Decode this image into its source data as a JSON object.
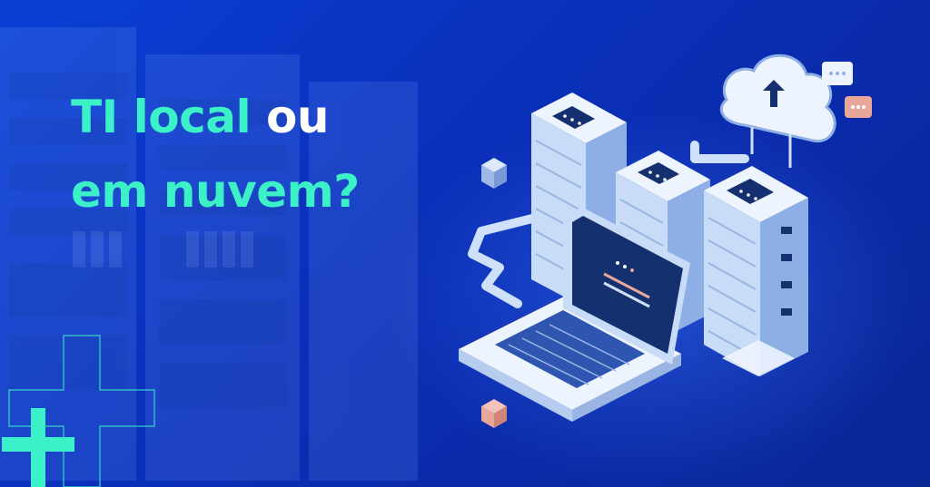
{
  "headline": {
    "part1": "TI local",
    "part2": "ou",
    "part3": "em nuvem?"
  },
  "colors": {
    "background": "#0a34c8",
    "accent": "#3cf0c8",
    "text": "#ffffff",
    "server": "#c9dcf7",
    "server_dark": "#14306e",
    "coral": "#e9a79c"
  },
  "icons": [
    "server-rack-icon",
    "laptop-icon",
    "cloud-upload-icon",
    "chat-bubble-icon",
    "cube-icon",
    "plus-icon"
  ]
}
